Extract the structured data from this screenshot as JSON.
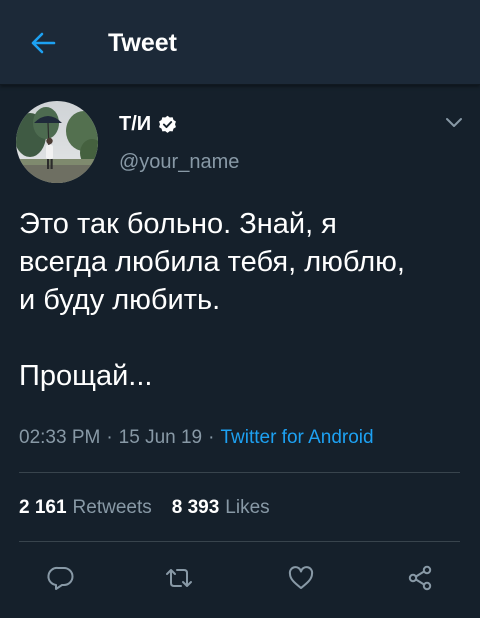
{
  "header": {
    "title": "Tweet",
    "back_icon": "arrow-left-icon"
  },
  "author": {
    "display_name": "Т/И",
    "verified": true,
    "handle": "@your_name",
    "avatar_icon": "profile-photo"
  },
  "tweet": {
    "text": "Это так больно. Знай, я\nвсегда любила тебя, люблю,\nи буду любить.\n\nПрощай...",
    "time": "02:33 PM",
    "date": "15 Jun 19",
    "source": "Twitter for Android"
  },
  "stats": {
    "retweets_count": "2 161",
    "retweets_label": "Retweets",
    "likes_count": "8 393",
    "likes_label": "Likes"
  },
  "actions": [
    "reply-icon",
    "retweet-icon",
    "like-icon",
    "share-icon"
  ],
  "colors": {
    "background": "#15202b",
    "header_background": "#1c2938",
    "accent": "#1da1f2",
    "secondary_text": "#8899a6",
    "divider": "#38444d"
  }
}
